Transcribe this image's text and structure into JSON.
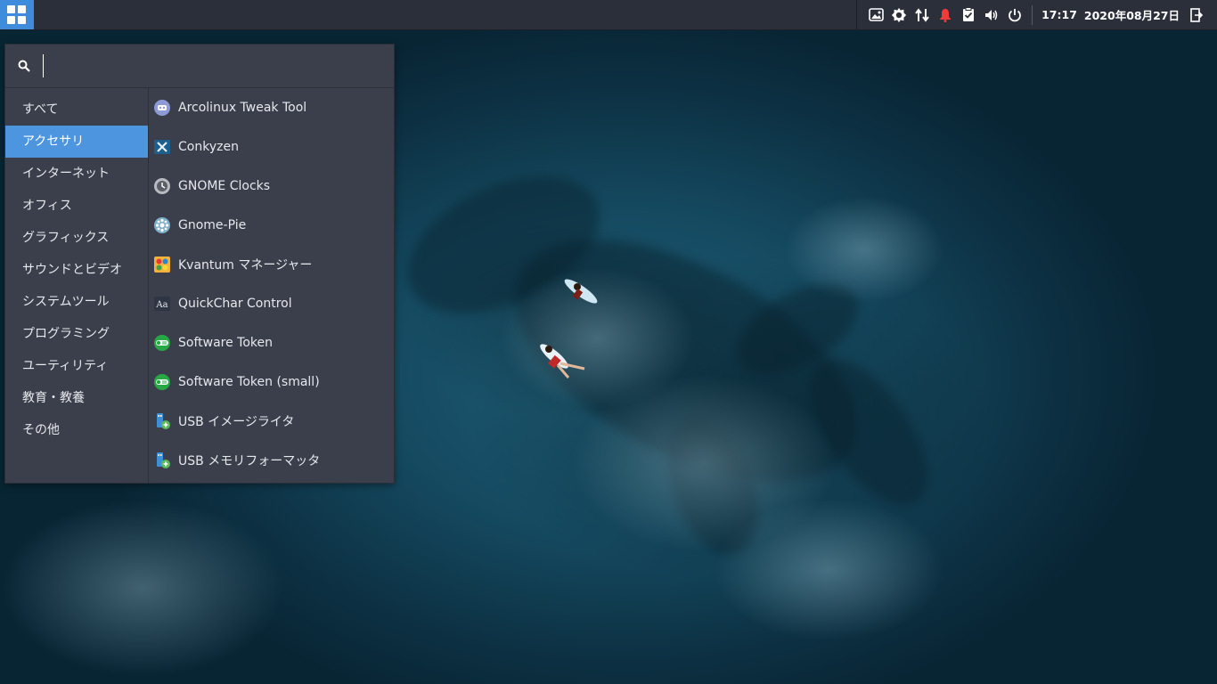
{
  "panel": {
    "menu_button_icon": "app-grid-icon",
    "tray_icons": [
      "image-viewer-icon",
      "settings-gear-icon",
      "network-transfer-icon",
      "notification-bell-icon",
      "clipboard-icon",
      "volume-icon",
      "power-icon"
    ],
    "clock": "17:17",
    "date": "2020年08月27日",
    "logout_icon": "logout-icon",
    "accent_color": "#3f8bdc"
  },
  "app_menu": {
    "search": {
      "value": "",
      "icon": "search-icon"
    },
    "categories": [
      {
        "label": "すべて",
        "active": false
      },
      {
        "label": "アクセサリ",
        "active": true
      },
      {
        "label": "インターネット",
        "active": false
      },
      {
        "label": "オフィス",
        "active": false
      },
      {
        "label": "グラフィックス",
        "active": false
      },
      {
        "label": "サウンドとビデオ",
        "active": false
      },
      {
        "label": "システムツール",
        "active": false
      },
      {
        "label": "プログラミング",
        "active": false
      },
      {
        "label": "ユーティリティ",
        "active": false
      },
      {
        "label": "教育・教養",
        "active": false
      },
      {
        "label": "その他",
        "active": false
      }
    ],
    "apps": [
      {
        "label": "Arcolinux Tweak Tool",
        "icon": "arcolinux-tweak-icon"
      },
      {
        "label": "Conkyzen",
        "icon": "conkyzen-icon"
      },
      {
        "label": "GNOME Clocks",
        "icon": "clock-icon"
      },
      {
        "label": "Gnome-Pie",
        "icon": "gnome-pie-icon"
      },
      {
        "label": "Kvantum マネージャー",
        "icon": "kvantum-icon"
      },
      {
        "label": "QuickChar Control",
        "icon": "quickchar-icon"
      },
      {
        "label": "Software Token",
        "icon": "token-icon"
      },
      {
        "label": "Software Token (small)",
        "icon": "token-icon"
      },
      {
        "label": "USB イメージライタ",
        "icon": "usb-writer-icon"
      },
      {
        "label": "USB メモリフォーマッタ",
        "icon": "usb-formatter-icon"
      }
    ]
  }
}
